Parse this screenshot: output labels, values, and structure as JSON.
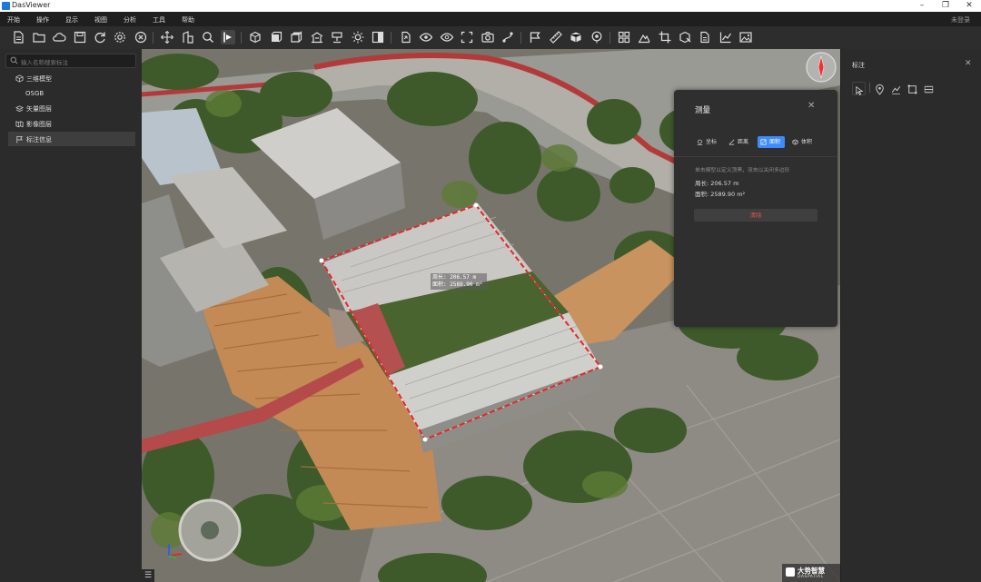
{
  "app": {
    "title": "DasViewer"
  },
  "menu": {
    "items": [
      "开始",
      "操作",
      "显示",
      "视图",
      "分析",
      "工具",
      "帮助"
    ],
    "login": "未登录"
  },
  "toolbar": {
    "icons": [
      "new-file-icon",
      "open-folder-icon",
      "cloud-icon",
      "save-icon",
      "refresh-icon",
      "settings-icon",
      "close-circle-icon",
      "move-icon",
      "building-icon",
      "search-icon",
      "play-marker-icon",
      "cube-view-icon",
      "cube-front-icon",
      "cube-top-icon",
      "pavilion-icon",
      "monument-icon",
      "sun-icon",
      "half-square-icon",
      "export-icon",
      "eye-icon",
      "eye-alt-icon",
      "frame-icon",
      "camera-icon",
      "path-icon",
      "flag-icon",
      "ruler-icon",
      "box-icon",
      "pin-icon",
      "grid-icon",
      "elevation-icon",
      "crop-icon",
      "cube-cut-icon",
      "document-icon",
      "chart-line-icon",
      "image-icon"
    ]
  },
  "left_panel": {
    "search_placeholder": "输入名称搜索标注",
    "tree": [
      {
        "label": "三维模型",
        "icon": "cube-icon",
        "indent": false,
        "selected": false
      },
      {
        "label": "OSGB",
        "icon": "",
        "indent": true,
        "selected": false
      },
      {
        "label": "矢量图层",
        "icon": "layers-icon",
        "indent": false,
        "selected": false
      },
      {
        "label": "影像图层",
        "icon": "map-icon",
        "indent": false,
        "selected": false
      },
      {
        "label": "标注信息",
        "icon": "flag-icon",
        "indent": false,
        "selected": true
      }
    ]
  },
  "right_panel": {
    "title": "标注",
    "tools": [
      "cursor-icon",
      "pin-icon",
      "polyline-icon",
      "rectangle-icon",
      "area-icon"
    ]
  },
  "measure_panel": {
    "title": "测量",
    "tabs": [
      {
        "label": "坐标",
        "icon": "coordinate-icon",
        "active": false
      },
      {
        "label": "距离",
        "icon": "distance-icon",
        "active": false
      },
      {
        "label": "面积",
        "icon": "area-icon",
        "active": true
      },
      {
        "label": "体积",
        "icon": "volume-icon",
        "active": false
      }
    ],
    "hint": "单击模型以定义顶黑，双击以关闭多边形",
    "perimeter": "周长: 206.57 m",
    "area": "面积: 2589.90 m²",
    "clear_button": "清除"
  },
  "map_overlay": {
    "label_perimeter": "周长: 206.57 m",
    "label_area": "面积: 2589.90 m²"
  },
  "brand": {
    "name_cn": "大势智慧",
    "name_en": "DASPATIAL"
  },
  "colors": {
    "accent": "#3e8bff",
    "measure_line": "#e8262b"
  }
}
